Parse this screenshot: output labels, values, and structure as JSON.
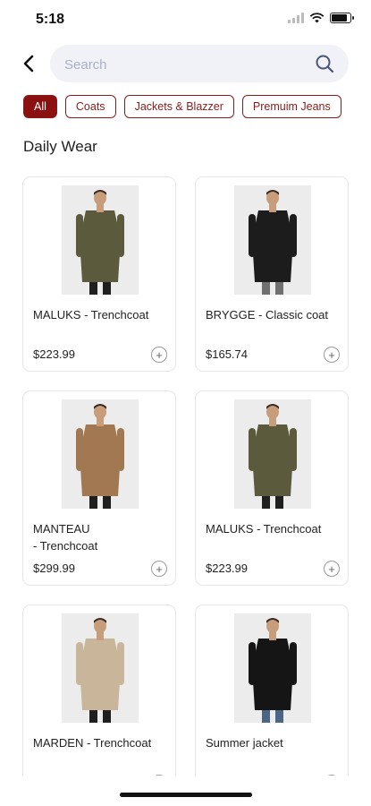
{
  "status": {
    "time": "5:18"
  },
  "search": {
    "placeholder": "Search"
  },
  "filters": [
    {
      "label": "All",
      "active": true
    },
    {
      "label": "Coats",
      "active": false
    },
    {
      "label": "Jackets & Blazzer",
      "active": false
    },
    {
      "label": "Premuim Jeans",
      "active": false
    }
  ],
  "section": {
    "title": "Daily Wear"
  },
  "products": [
    {
      "name": "MALUKS - Trenchcoat",
      "price": "$223.99",
      "coat_color": "#5c5a3c",
      "pants_color": "#1f1f1f"
    },
    {
      "name": "BRYGGE - Classic coat",
      "price": "$165.74",
      "coat_color": "#1c1c1c",
      "pants_color": "#707070"
    },
    {
      "name": "MANTEAU\n- Trenchcoat",
      "price": "$299.99",
      "coat_color": "#a17852",
      "pants_color": "#1f1f1f"
    },
    {
      "name": "MALUKS - Trenchcoat",
      "price": "$223.99",
      "coat_color": "#5c5a3c",
      "pants_color": "#1f1f1f"
    },
    {
      "name": "MARDEN - Trenchcoat",
      "price": "",
      "coat_color": "#c9b69a",
      "pants_color": "#1f1f1f"
    },
    {
      "name": "Summer jacket",
      "price": "",
      "coat_color": "#151515",
      "pants_color": "#4b6587"
    }
  ],
  "colors": {
    "accent": "#8b1111",
    "search_bg": "#f0f2f8"
  },
  "icons": {
    "back": "chevron-left-icon",
    "search": "search-icon",
    "add": "plus-icon"
  }
}
